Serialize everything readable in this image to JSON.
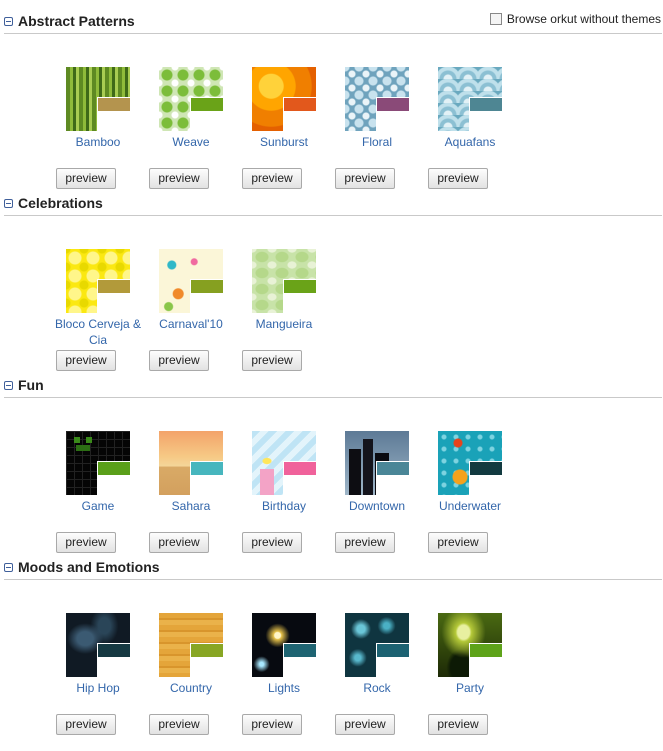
{
  "browse_label": "Browse orkut without themes",
  "sections": [
    {
      "title": "Abstract Patterns",
      "items": [
        {
          "name": "Bamboo",
          "swatch": "#b4944e"
        },
        {
          "name": "Weave",
          "swatch": "#6aa318"
        },
        {
          "name": "Sunburst",
          "swatch": "#e2581c"
        },
        {
          "name": "Floral",
          "swatch": "#8a4a78"
        },
        {
          "name": "Aquafans",
          "swatch": "#4e8693"
        }
      ]
    },
    {
      "title": "Celebrations",
      "items": [
        {
          "name": "Bloco Cerveja & Cia",
          "swatch": "#b29a3a"
        },
        {
          "name": "Carnaval'10",
          "swatch": "#86a020"
        },
        {
          "name": "Mangueira",
          "swatch": "#6aa318"
        }
      ]
    },
    {
      "title": "Fun",
      "items": [
        {
          "name": "Game",
          "swatch": "#5a9f1a"
        },
        {
          "name": "Sahara",
          "swatch": "#47b6be"
        },
        {
          "name": "Birthday",
          "swatch": "#f0629b"
        },
        {
          "name": "Downtown",
          "swatch": "#4a8697"
        },
        {
          "name": "Underwater",
          "swatch": "#123a40"
        }
      ]
    },
    {
      "title": "Moods and Emotions",
      "items": [
        {
          "name": "Hip Hop",
          "swatch": "#163942"
        },
        {
          "name": "Country",
          "swatch": "#88a624"
        },
        {
          "name": "Lights",
          "swatch": "#1e6472"
        },
        {
          "name": "Rock",
          "swatch": "#1c6272"
        },
        {
          "name": "Party",
          "swatch": "#5ea31a"
        }
      ]
    }
  ],
  "preview_label": "preview"
}
